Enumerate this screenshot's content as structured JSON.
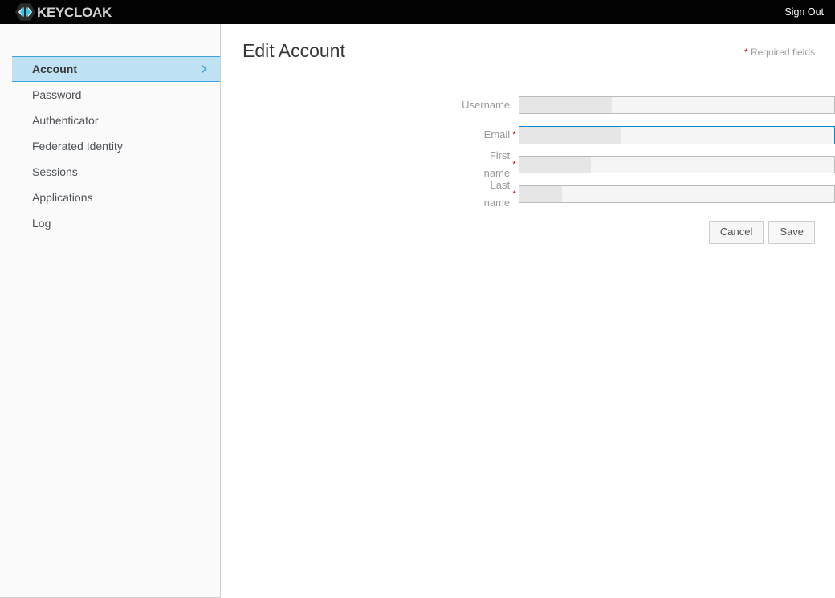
{
  "navbar": {
    "brand_text": "KEYCLOAK",
    "brand_icon": "keycloak-logo-icon",
    "signout_label": "Sign Out",
    "background_color": "#030303"
  },
  "sidebar": {
    "items": [
      {
        "label": "Account",
        "active": true,
        "chevron_icon": "chevron-right-icon"
      },
      {
        "label": "Password",
        "active": false
      },
      {
        "label": "Authenticator",
        "active": false
      },
      {
        "label": "Federated Identity",
        "active": false
      },
      {
        "label": "Sessions",
        "active": false
      },
      {
        "label": "Applications",
        "active": false
      },
      {
        "label": "Log",
        "active": false
      }
    ],
    "active_background_color": "#bee1f4",
    "active_border_color": "#39a5dc"
  },
  "main": {
    "page_title": "Edit Account",
    "required_note": {
      "star": "*",
      "label": "Required fields",
      "star_color": "#cc0000"
    },
    "form": {
      "fields": [
        {
          "label": "Username",
          "required": false,
          "star": "",
          "value": "",
          "placeholder": "",
          "redacted": true,
          "redaction_width": 115,
          "focused": false
        },
        {
          "label": "Email",
          "required": true,
          "star": "*",
          "value": "",
          "placeholder": "",
          "redacted": true,
          "redaction_width": 127,
          "focused": true
        },
        {
          "label": "First name",
          "required": true,
          "star": "*",
          "value": "",
          "placeholder": "",
          "redacted": true,
          "redaction_width": 89,
          "focused": false
        },
        {
          "label": "Last name",
          "required": true,
          "star": "*",
          "value": "",
          "placeholder": "",
          "redacted": true,
          "redaction_width": 53,
          "focused": false
        }
      ],
      "cancel_label": "Cancel",
      "save_label": "Save",
      "focus_color": "#0088ce"
    }
  }
}
